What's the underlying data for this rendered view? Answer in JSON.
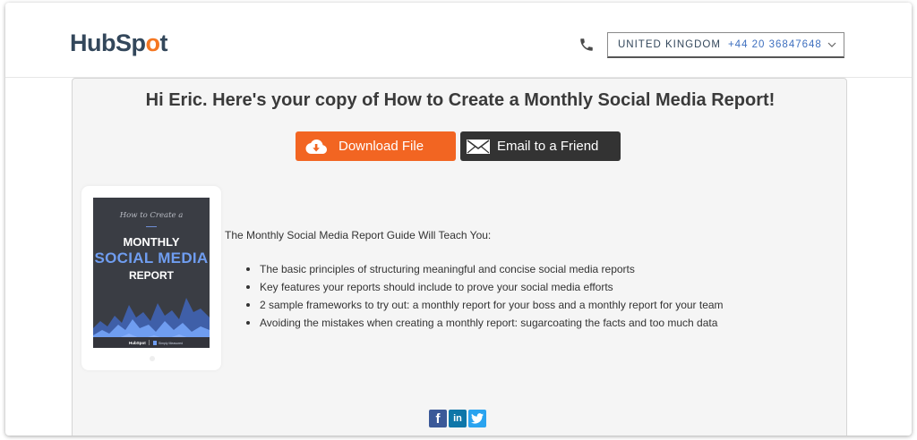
{
  "header": {
    "logo_text_before": "HubSp",
    "logo_text_o": "o",
    "logo_text_after": "t",
    "country": "UNITED KINGDOM",
    "phone": "+44 20 36847648"
  },
  "main": {
    "title": "Hi Eric. Here's your copy of How to Create a Monthly Social Media Report!",
    "download_label": "Download File",
    "email_label": "Email to a Friend",
    "lead": "The Monthly Social Media Report Guide Will Teach You:",
    "bullets": [
      "The basic principles of structuring meaningful and concise social media reports",
      "Key features your reports should include to prove your social media efforts",
      "2 sample frameworks to try out: a monthly report for your boss and a monthly report for your team",
      "Avoiding the mistakes when creating a monthly report: sugarcoating the facts and too much data"
    ]
  },
  "book": {
    "pre": "How to Create a",
    "line1": "MONTHLY",
    "line2": "SOCIAL MEDIA",
    "line3": "REPORT",
    "foot_left": "HubSpot",
    "foot_right": "Simply Measured"
  },
  "social": {
    "facebook": "f",
    "linkedin": "in"
  },
  "colors": {
    "brand_orange": "#f26522",
    "dark_button": "#333333",
    "link_blue": "#3d6fbf"
  },
  "icons": [
    "phone-icon",
    "chevron-down-icon",
    "cloud-download-icon",
    "envelope-icon",
    "facebook-icon",
    "linkedin-icon",
    "twitter-icon"
  ]
}
